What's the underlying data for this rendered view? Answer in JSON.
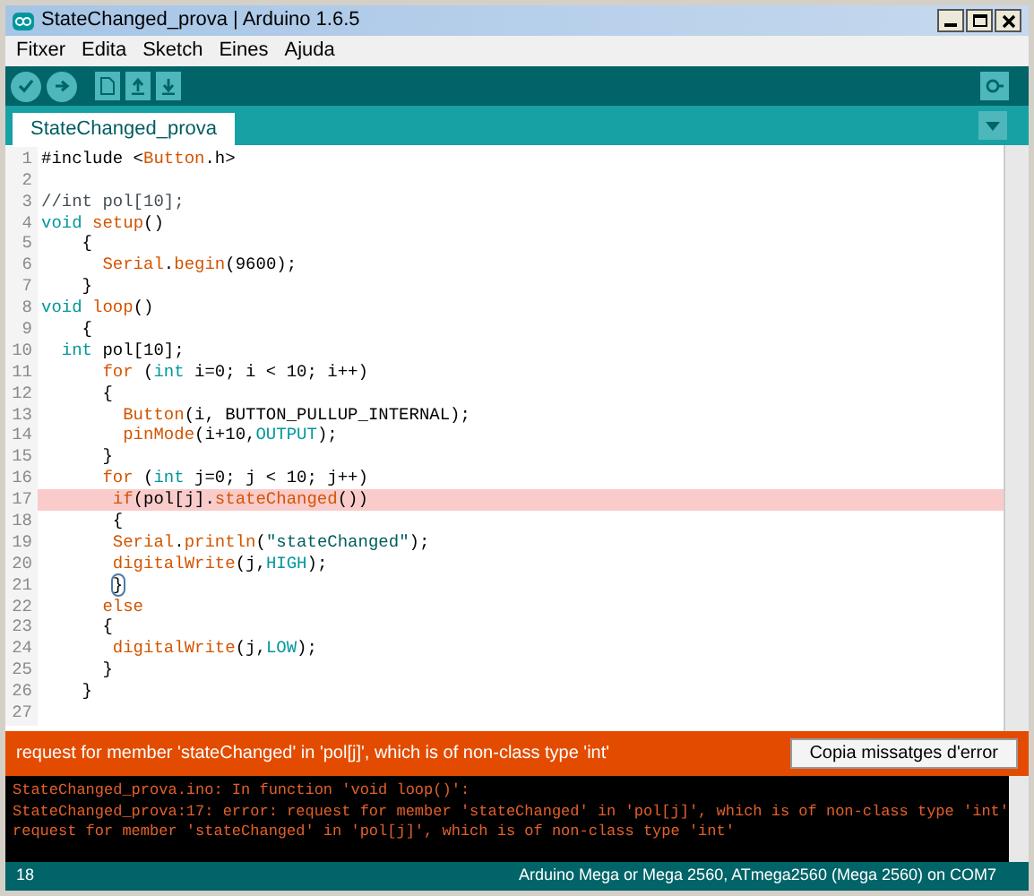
{
  "window": {
    "title": "StateChanged_prova | Arduino 1.6.5"
  },
  "menu": [
    "Fitxer",
    "Edita",
    "Sketch",
    "Eines",
    "Ajuda"
  ],
  "tabs": [
    {
      "label": "StateChanged_prova",
      "selected": true
    }
  ],
  "editor": {
    "lines": [
      {
        "number": "1",
        "highlighted": false,
        "tokens": [
          {
            "text": "#include <",
            "kind": "plain"
          },
          {
            "text": "Button",
            "kind": "function"
          },
          {
            "text": ".h>",
            "kind": "plain"
          }
        ]
      },
      {
        "number": "2",
        "highlighted": false
      },
      {
        "number": "3",
        "highlighted": false,
        "tokens": [
          {
            "text": "//int pol[10];",
            "kind": "comment"
          }
        ]
      },
      {
        "number": "4",
        "highlighted": false,
        "tokens": [
          {
            "text": "void",
            "kind": "keyword"
          },
          {
            "text": " setup",
            "kind": "function"
          },
          {
            "text": "()",
            "kind": "plain"
          }
        ]
      },
      {
        "number": "5",
        "highlighted": false,
        "tokens": [
          {
            "text": "    {",
            "kind": "plain"
          }
        ]
      },
      {
        "number": "6",
        "highlighted": false,
        "tokens": [
          {
            "text": "      Serial",
            "kind": "function"
          },
          {
            "text": ".",
            "kind": "plain"
          },
          {
            "text": "begin",
            "kind": "function"
          },
          {
            "text": "(9600);",
            "kind": "plain"
          }
        ]
      },
      {
        "number": "7",
        "highlighted": false,
        "tokens": [
          {
            "text": "    }",
            "kind": "plain"
          }
        ]
      },
      {
        "number": "8",
        "highlighted": false,
        "tokens": [
          {
            "text": "void",
            "kind": "keyword"
          },
          {
            "text": " loop",
            "kind": "function"
          },
          {
            "text": "()",
            "kind": "plain"
          }
        ]
      },
      {
        "number": "9",
        "highlighted": false,
        "tokens": [
          {
            "text": "    {",
            "kind": "plain"
          }
        ]
      },
      {
        "number": "10",
        "highlighted": false,
        "tokens": [
          {
            "text": "  int",
            "kind": "keyword"
          },
          {
            "text": " pol[10];",
            "kind": "plain"
          }
        ]
      },
      {
        "number": "11",
        "highlighted": false,
        "tokens": [
          {
            "text": "      for",
            "kind": "function"
          },
          {
            "text": " (",
            "kind": "plain"
          },
          {
            "text": "int",
            "kind": "keyword"
          },
          {
            "text": " i=0; i < 10; i++)",
            "kind": "plain"
          }
        ]
      },
      {
        "number": "12",
        "highlighted": false,
        "tokens": [
          {
            "text": "      {",
            "kind": "plain"
          }
        ]
      },
      {
        "number": "13",
        "highlighted": false,
        "tokens": [
          {
            "text": "        Button",
            "kind": "function"
          },
          {
            "text": "(i, BUTTON_PULLUP_INTERNAL);",
            "kind": "plain"
          }
        ]
      },
      {
        "number": "14",
        "highlighted": false,
        "tokens": [
          {
            "text": "        pinMode",
            "kind": "function"
          },
          {
            "text": "(i+10,",
            "kind": "plain"
          },
          {
            "text": "OUTPUT",
            "kind": "constant"
          },
          {
            "text": ");",
            "kind": "plain"
          }
        ]
      },
      {
        "number": "15",
        "highlighted": false,
        "tokens": [
          {
            "text": "      }",
            "kind": "plain"
          }
        ]
      },
      {
        "number": "16",
        "highlighted": false,
        "tokens": [
          {
            "text": "      for",
            "kind": "function"
          },
          {
            "text": " (",
            "kind": "plain"
          },
          {
            "text": "int",
            "kind": "keyword"
          },
          {
            "text": " j=0; j < 10; j++)",
            "kind": "plain"
          }
        ]
      },
      {
        "number": "17",
        "highlighted": true,
        "tokens": [
          {
            "text": "       if",
            "kind": "function"
          },
          {
            "text": "(pol[j].",
            "kind": "plain"
          },
          {
            "text": "stateChanged",
            "kind": "function"
          },
          {
            "text": "())",
            "kind": "plain"
          }
        ]
      },
      {
        "number": "18",
        "highlighted": false,
        "tokens": [
          {
            "text": "       {",
            "kind": "plain"
          }
        ]
      },
      {
        "number": "19",
        "highlighted": false,
        "tokens": [
          {
            "text": "       Serial",
            "kind": "function"
          },
          {
            "text": ".",
            "kind": "plain"
          },
          {
            "text": "println",
            "kind": "function"
          },
          {
            "text": "(",
            "kind": "plain"
          },
          {
            "text": "\"stateChanged\"",
            "kind": "string"
          },
          {
            "text": ");",
            "kind": "plain"
          }
        ]
      },
      {
        "number": "20",
        "highlighted": false,
        "tokens": [
          {
            "text": "       digitalWrite",
            "kind": "function"
          },
          {
            "text": "(j,",
            "kind": "plain"
          },
          {
            "text": "HIGH",
            "kind": "constant"
          },
          {
            "text": ");",
            "kind": "plain"
          }
        ]
      },
      {
        "number": "21",
        "highlighted": false,
        "tokens": [
          {
            "text": "       }",
            "kind": "bracket-match"
          }
        ]
      },
      {
        "number": "22",
        "highlighted": false,
        "tokens": [
          {
            "text": "      else",
            "kind": "function"
          }
        ]
      },
      {
        "number": "23",
        "highlighted": false,
        "tokens": [
          {
            "text": "      {",
            "kind": "plain"
          }
        ]
      },
      {
        "number": "24",
        "highlighted": false,
        "tokens": [
          {
            "text": "       digitalWrite",
            "kind": "function"
          },
          {
            "text": "(j,",
            "kind": "plain"
          },
          {
            "text": "LOW",
            "kind": "constant"
          },
          {
            "text": ");",
            "kind": "plain"
          }
        ]
      },
      {
        "number": "25",
        "highlighted": false,
        "tokens": [
          {
            "text": "      }",
            "kind": "plain"
          }
        ]
      },
      {
        "number": "26",
        "highlighted": false,
        "tokens": [
          {
            "text": "    }",
            "kind": "plain"
          }
        ]
      },
      {
        "number": "27",
        "highlighted": false
      }
    ]
  },
  "error_bar": {
    "message": "request for member 'stateChanged' in 'pol[j]', which is of non-class type 'int'",
    "button": "Copia missatges d'error"
  },
  "console": [
    "StateChanged_prova.ino: In function 'void loop()':",
    "StateChanged_prova:17: error: request for member 'stateChanged' in 'pol[j]', which is of non-class type 'int'",
    "request for member 'stateChanged' in 'pol[j]', which is of non-class type 'int'"
  ],
  "status_bar": {
    "line": "18",
    "board": "Arduino Mega or Mega 2560, ATmega2560 (Mega 2560) on COM7"
  }
}
